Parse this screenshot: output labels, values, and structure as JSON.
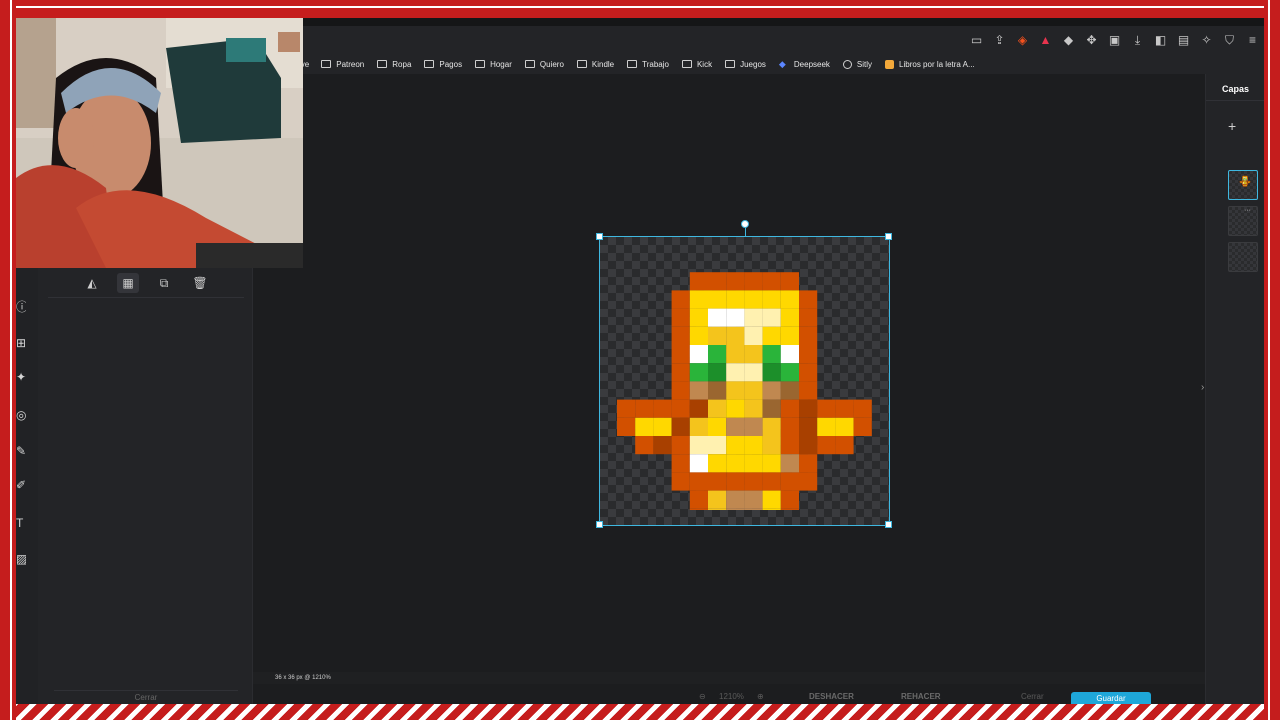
{
  "bookmarks": [
    {
      "label": "ive",
      "icon": "none"
    },
    {
      "label": "Patreon",
      "icon": "folder"
    },
    {
      "label": "Ropa",
      "icon": "folder"
    },
    {
      "label": "Pagos",
      "icon": "folder"
    },
    {
      "label": "Hogar",
      "icon": "folder"
    },
    {
      "label": "Quiero",
      "icon": "folder"
    },
    {
      "label": "Kindle",
      "icon": "folder"
    },
    {
      "label": "Trabajo",
      "icon": "folder"
    },
    {
      "label": "Kick",
      "icon": "folder"
    },
    {
      "label": "Juegos",
      "icon": "folder"
    },
    {
      "label": "Deepseek",
      "icon": "deepseek"
    },
    {
      "label": "Sitly",
      "icon": "globe"
    },
    {
      "label": "Libros por la letra A...",
      "icon": "book"
    }
  ],
  "layers": {
    "title": "Capas",
    "add_label": "+"
  },
  "canvas": {
    "size_info": "36 x 36 px @ 1210%"
  },
  "bottom_bar": {
    "close": "Cerrar",
    "zoom": "1210%",
    "undo": "DESHACER",
    "redo": "REHACER",
    "cancel": "Cerrar",
    "save": "Guardar"
  },
  "colors": {
    "accent": "#1ea7d9",
    "frame_red": "#c51d1d",
    "selection": "#3fb8e0"
  },
  "pixel_palette": {
    ".": "transparent",
    "D": "#d25000",
    "d": "#a84000",
    "O": "#ea7a18",
    "Y": "#ffd800",
    "y": "#f4c41c",
    "W": "#ffffff",
    "w": "#fff1b0",
    "G": "#2ab43a",
    "g": "#1c8f2a",
    "B": "#c08850",
    "b": "#9a6630"
  },
  "pixel_rows": [
    "..............",
    "....DDDDDD....",
    "...DYYYYYYD...",
    "...DYWWwwYD...",
    "...DYyywYYD...",
    "...DWGyyGWD...",
    "...DGgwwgGD...",
    "...DBbyyBbD...",
    "DDDDdyYybDdDDD",
    "DYYdyYBByDdYYD",
    ".DdDwwYYyDdDD.",
    "...DWYYYYBD...",
    "...DDDDDDDD...",
    "....DyBBYD....",
    "....DyBBYD....",
    ".....dddd....."
  ]
}
